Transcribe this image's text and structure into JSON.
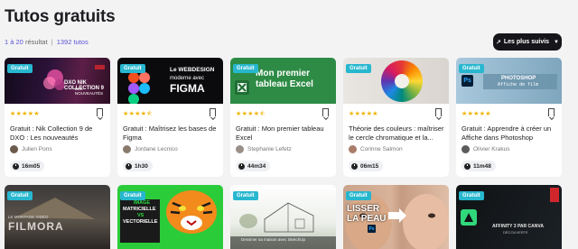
{
  "page": {
    "title": "Tutos gratuits",
    "results_range": "1 à 20",
    "results_label": "résultat",
    "results_total": "1392 tutos",
    "sort_label": "Les plus suivis"
  },
  "colors": {
    "accent": "#5a52d6",
    "badge": "#27b7cf",
    "star": "#f2b300",
    "button": "#16161a"
  },
  "cards": [
    {
      "badge": "Gratuit",
      "thumb_line1": "DXO NIK COLLECTION 9",
      "thumb_line2": "LES NOUVEAUTÉS",
      "stars": "★★★★★",
      "title": "Gratuit : Nik Collection 9 de DXO : Les nouveautés",
      "author": "Julien Pons",
      "duration": "16m05"
    },
    {
      "badge": "Gratuit",
      "thumb_line1": "Le WEBDESIGN",
      "thumb_line2": "moderne avec",
      "thumb_line3": "FIGMA",
      "stars": "★★★★⯪",
      "title": "Gratuit : Maîtrisez les bases de Figma",
      "author": "Jordane Lecnico",
      "duration": "1h30"
    },
    {
      "badge": "Gratuit",
      "thumb_line1": "Mon premier",
      "thumb_line2": "tableau Excel",
      "stars": "★★★★⯪",
      "title": "Gratuit : Mon premier tableau Excel",
      "author": "Stephanie Lefetz",
      "duration": "44m34"
    },
    {
      "badge": "Gratuit",
      "stars": "★★★★★",
      "title": "Théorie des couleurs : maîtriser le cercle chromatique et la...",
      "author": "Corinne Salmon",
      "duration": "06m15"
    },
    {
      "badge": "Gratuit",
      "thumb_line1": "PHOTOSHOP",
      "thumb_line2": "Affiche de film",
      "stars": "★★★★★",
      "title": "Gratuit : Apprendre à créer un Affiche dans Photoshop",
      "author": "Olivier Krakus",
      "duration": "11m48"
    }
  ],
  "cards_row2": [
    {
      "badge": "Gratuit",
      "thumb_line1": "LE MONTAGE VIDÉO",
      "thumb_line2": "FILMORA"
    },
    {
      "badge": "Gratuit",
      "thumb_line1": "IMAGE",
      "thumb_line2": "MATRICIELLE",
      "thumb_line3": "VS",
      "thumb_line4": "VECTORIELLE"
    },
    {
      "badge": "Gratuit",
      "thumb_line1": "Dessiner sa maison avec SketchUp"
    },
    {
      "badge": "Gratuit",
      "thumb_line1": "LISSER",
      "thumb_line2": "LA PEAU"
    },
    {
      "badge": "Gratuit",
      "thumb_line1": "AFFINITY 3 PAR CANVA",
      "thumb_line2": "DÉCOUVERTE"
    }
  ]
}
